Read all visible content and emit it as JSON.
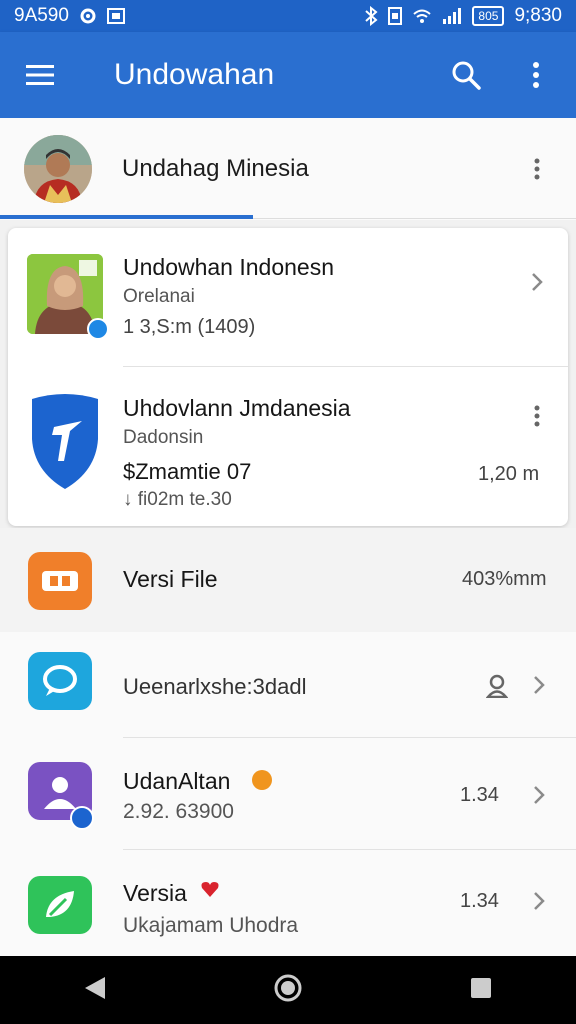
{
  "status_bar": {
    "left_text": "9A590",
    "time": "9;830",
    "battery_text": "805",
    "icons": [
      "sync-icon",
      "notification-icon",
      "bluetooth-icon",
      "sim-icon",
      "wifi-icon",
      "signal-icon",
      "battery-icon"
    ]
  },
  "app_bar": {
    "title": "Undowahan",
    "icons": [
      "menu-icon",
      "search-icon",
      "more-vert-icon"
    ],
    "color": "#2a6fd0"
  },
  "profile": {
    "name": "Undahag Minesia"
  },
  "items": [
    {
      "title": "Undowhan Indonesn",
      "subtitle": "Orelanai",
      "meta": "1 3,S:m (1409)"
    },
    {
      "title": "Uhdovlann Jmdanesia",
      "subtitle": "Dadonsin",
      "line3": "$Zmamtie 07",
      "line4": "↓ fi02m te.30",
      "right_value": "1,20 m"
    },
    {
      "title": "Versi File",
      "right_value": "403%mm"
    },
    {
      "title": "Ueenarlxshe:3dadl"
    },
    {
      "title": "UdanAltan",
      "subtitle": "2.92. 63900",
      "right_value": "1.34"
    },
    {
      "title": "Versia",
      "subtitle": "Ukajamam Uhodra",
      "right_value": "1.34"
    }
  ],
  "colors": {
    "accent": "#2a6fd0",
    "orange": "#f07f2a",
    "cyan": "#1ea6dd",
    "purple": "#7a52c2",
    "green": "#2fc35a",
    "shield_blue": "#1c64cf"
  }
}
